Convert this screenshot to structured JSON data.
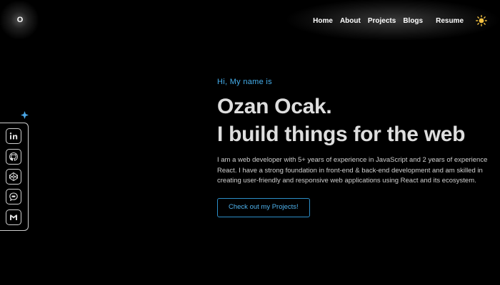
{
  "logo": {
    "text": "O"
  },
  "nav": {
    "items": [
      {
        "label": "Home"
      },
      {
        "label": "About"
      },
      {
        "label": "Projects"
      },
      {
        "label": "Blogs"
      }
    ],
    "resume_label": "Resume",
    "theme_toggle_icon": "sun-icon"
  },
  "sidebar": {
    "sparkle_icon": "sparkle-icon",
    "links": [
      {
        "icon": "linkedin-icon"
      },
      {
        "icon": "github-icon"
      },
      {
        "icon": "codepen-icon"
      },
      {
        "icon": "message-icon"
      },
      {
        "icon": "gmail-icon"
      }
    ]
  },
  "hero": {
    "greeting": "Hi, My name is",
    "name": "Ozan Ocak.",
    "tagline": "I build things for the web",
    "description": "I am a web developer with 5+ years of experience in JavaScript and 2 years of experience React. I have a strong foundation in front-end & back-end development and am skilled in creating user-friendly and responsive web applications using React and its ecosystem.",
    "cta_label": "Check out my Projects!"
  },
  "colors": {
    "background": "#000000",
    "accent": "#45aeec",
    "heading": "#dedede",
    "sun": "#f5c242"
  }
}
